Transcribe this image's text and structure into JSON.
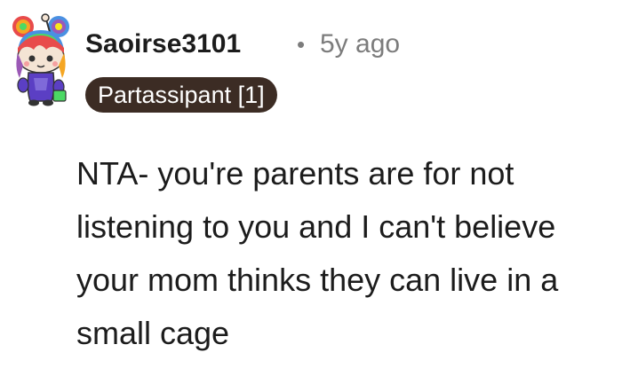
{
  "comment": {
    "author": "Saoirse3101",
    "separator": "•",
    "timestamp": "5y ago",
    "flair": "Partassipant [1]",
    "body": "NTA- you're parents are for not listening to you and I can't believe your mom thinks they can live in a small cage"
  },
  "avatar": {
    "icon": "snoo-avatar-icon",
    "colors": {
      "hair_rainbow": [
        "#e84b4b",
        "#f5a623",
        "#f8e71c",
        "#4cd964",
        "#4a90e2",
        "#9b59b6"
      ],
      "skin": "#f4e4d4",
      "outfit": "#5b3fc4"
    }
  },
  "colors": {
    "text_primary": "#1c1c1c",
    "text_muted": "#7c7c7c",
    "flair_bg": "#3c2c24",
    "flair_text": "#ffffff",
    "background": "#ffffff"
  }
}
